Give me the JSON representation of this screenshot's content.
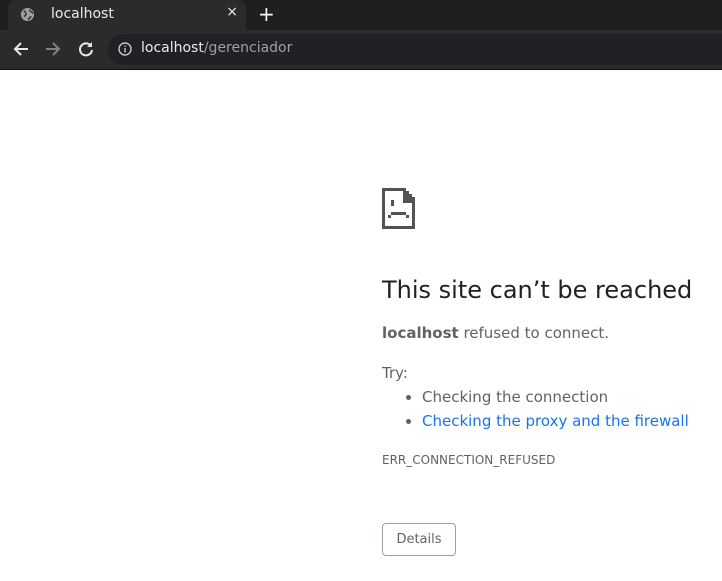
{
  "tab": {
    "title": "localhost",
    "close": "×",
    "new_tab": "+"
  },
  "omnibox": {
    "host": "localhost",
    "path": "/gerenciador"
  },
  "error": {
    "heading": "This site can’t be reached",
    "host": "localhost",
    "message": " refused to connect.",
    "try_label": "Try:",
    "suggestions": [
      "Checking the connection",
      "Checking the proxy and the firewall"
    ],
    "code": "ERR_CONNECTION_REFUSED",
    "details_label": "Details"
  },
  "colors": {
    "link": "#1a73e8",
    "text": "#5f6368",
    "heading": "#202124"
  }
}
